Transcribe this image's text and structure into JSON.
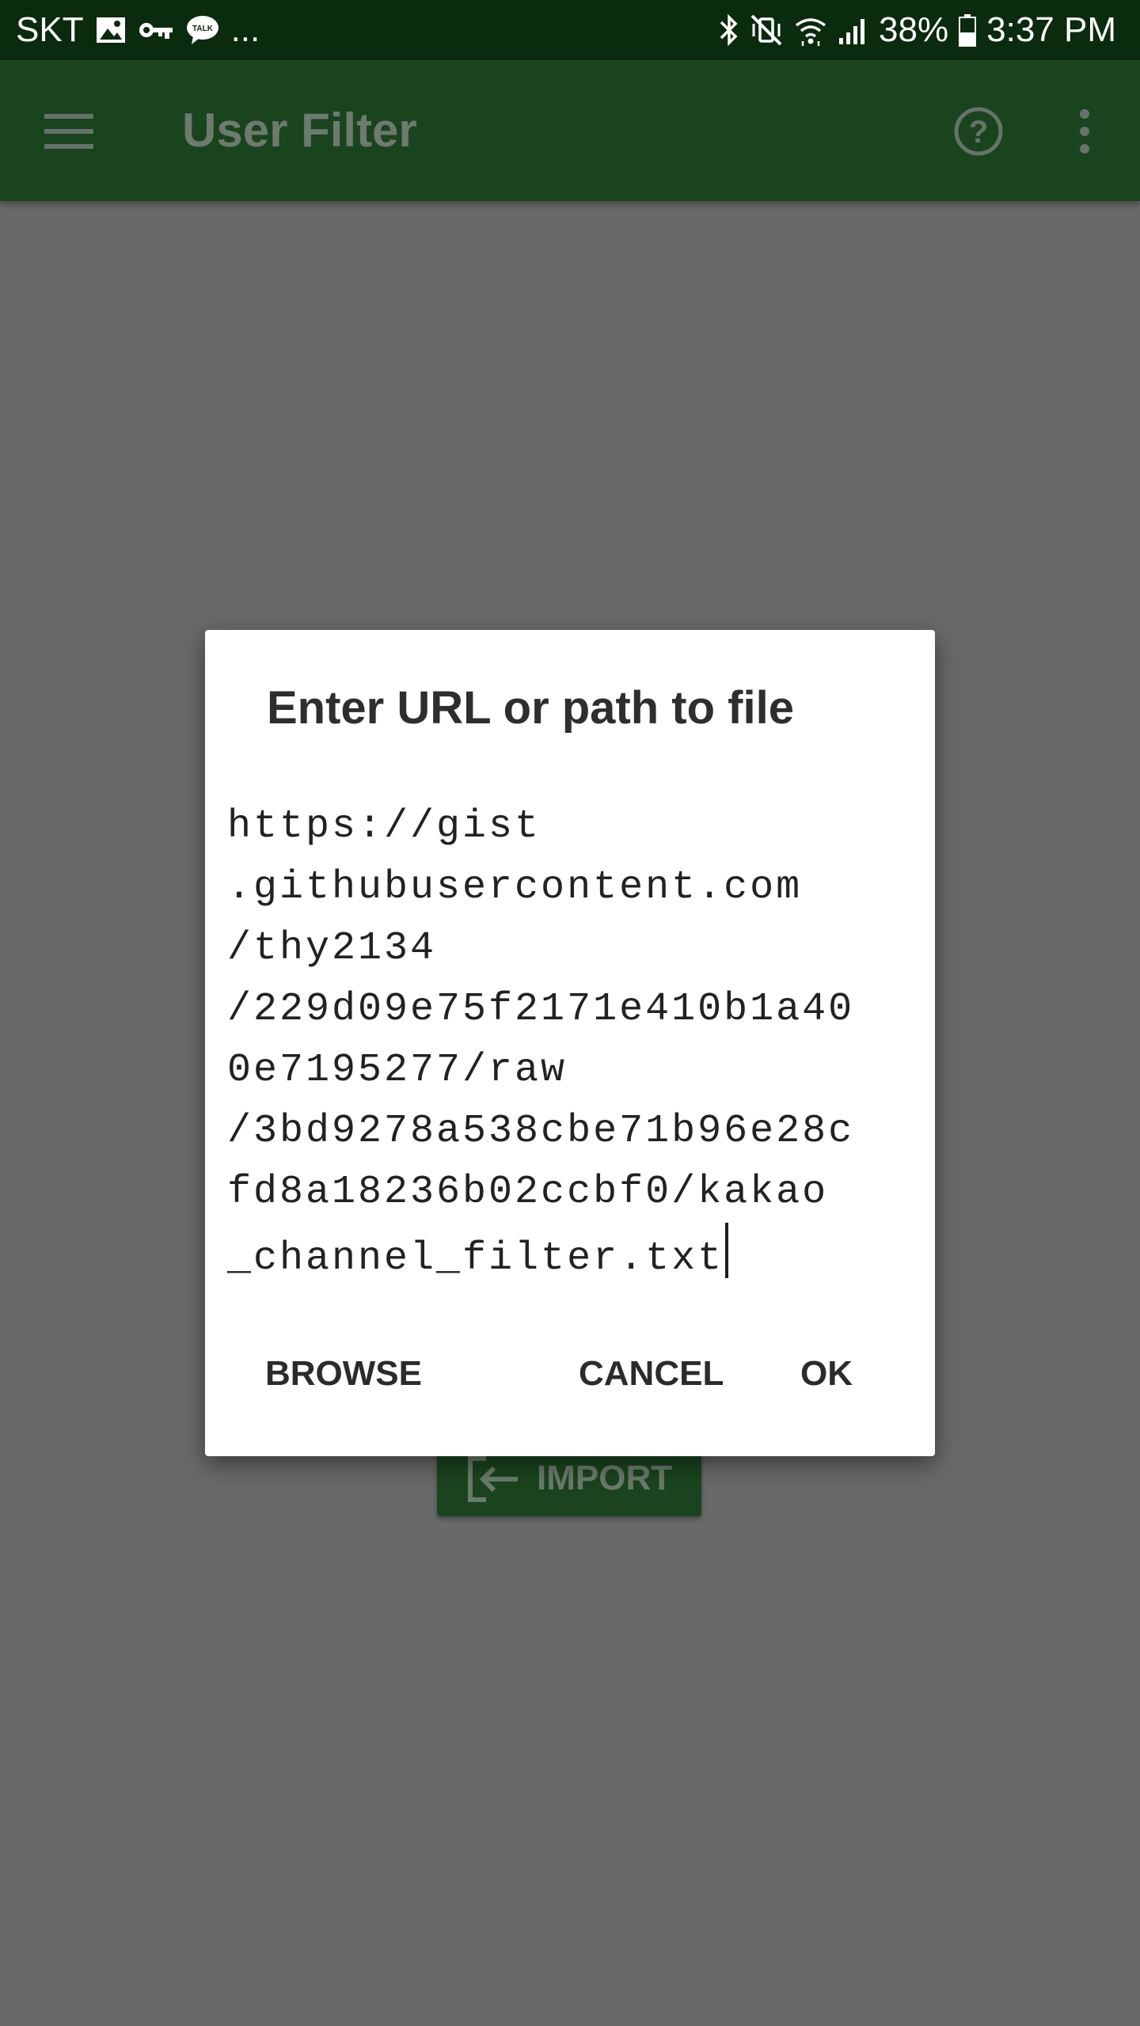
{
  "status_bar": {
    "carrier": "SKT",
    "notification_icons": [
      "image-icon",
      "key-icon",
      "talk-icon"
    ],
    "more_indicator": "...",
    "right_icons": [
      "bluetooth-icon",
      "vibrate-mute-icon",
      "wifi-icon",
      "signal-icon",
      "battery-icon"
    ],
    "battery": "38%",
    "time": "3:37 PM"
  },
  "app_bar": {
    "title": "User Filter",
    "icons": [
      "hamburger-menu-icon",
      "help-icon",
      "overflow-menu-icon"
    ]
  },
  "background": {
    "import_label": "IMPORT"
  },
  "dialog": {
    "title": "Enter URL or path to file",
    "input_lines": [
      "https://gist",
      ".githubusercontent.com",
      "/thy2134",
      "/229d09e75f2171e410b1a40",
      "0e7195277/raw",
      "/3bd9278a538cbe71b96e28c",
      "fd8a18236b02ccbf0/kakao",
      "_channel_filter.txt"
    ],
    "browse_label": "BROWSE",
    "cancel_label": "CANCEL",
    "ok_label": "OK"
  },
  "colors": {
    "status_bar_bg": "#0a2b0e",
    "app_bar_bg": "#1a441e",
    "scrim": "#696969",
    "dialog_bg": "#ffffff"
  }
}
